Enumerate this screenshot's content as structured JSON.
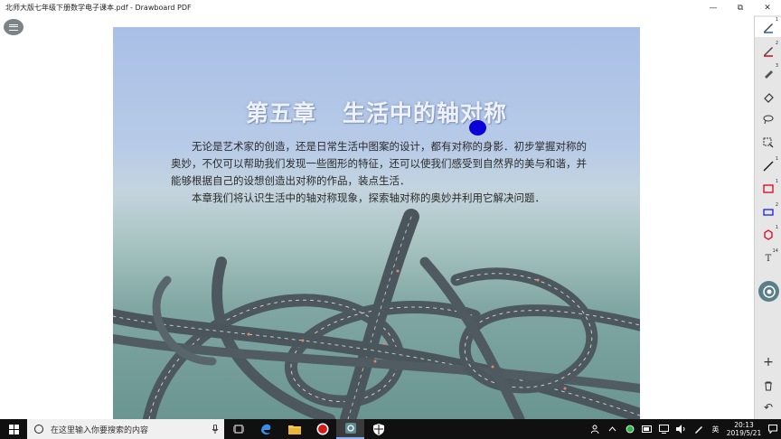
{
  "window": {
    "title": "北师大版七年级下册数学电子课本.pdf - Drawboard PDF",
    "minimize_glyph": "—",
    "restore_glyph": "⧉",
    "close_glyph": "✕"
  },
  "page": {
    "chapter_title": "第五章   生活中的轴对称",
    "paragraphs": [
      "无论是艺术家的创造，还是日常生活中图案的设计，都有对称的身影．初步掌握对称的奥妙，不仅可以帮助我们发现一些图形的特征，还可以使我们感受到自然界的美与和谐，并能够根据自己的设想创造出对称的作品，装点生活．",
      "本章我们将认识生活中的轴对称现象，探索轴对称的奥妙并利用它解决问题．"
    ],
    "pen_dot_color": "#0b00d8"
  },
  "toolbar": {
    "tools": [
      {
        "name": "pen-1",
        "num": "1",
        "color": "#1a5ed8"
      },
      {
        "name": "pen-2",
        "num": "2",
        "color": "#e0001a"
      },
      {
        "name": "pen-3",
        "num": "3",
        "color": "#222222"
      },
      {
        "name": "eraser",
        "num": "",
        "color": "#333333"
      },
      {
        "name": "lasso",
        "num": "",
        "color": "#333333"
      },
      {
        "name": "select",
        "num": "",
        "color": "#333333"
      },
      {
        "name": "line",
        "num": "1",
        "color": "#111111"
      },
      {
        "name": "rectangle",
        "num": "1",
        "color": "#e0001a"
      },
      {
        "name": "rectangle-blue",
        "num": "2",
        "color": "#1a1aff"
      },
      {
        "name": "ellipse",
        "num": "1",
        "color": "#e0001a"
      },
      {
        "name": "text",
        "num": "14",
        "color": "#333333"
      }
    ],
    "text_tool_glyph": "T",
    "add_glyph": "+",
    "delete_glyph": "🗑",
    "undo_glyph": "↶"
  },
  "taskbar": {
    "search_placeholder": "在这里输入你要搜索的内容",
    "tray": {
      "language": "英",
      "time": "20:13",
      "date": "2019/5/21"
    }
  }
}
